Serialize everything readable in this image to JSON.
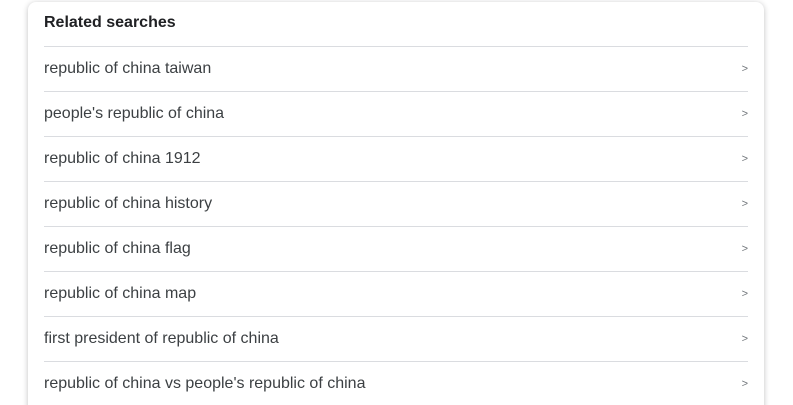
{
  "related_searches": {
    "title": "Related searches",
    "chevron_glyph": ">",
    "items": [
      {
        "label": "republic of china taiwan"
      },
      {
        "label": "people's republic of china"
      },
      {
        "label": "republic of china 1912"
      },
      {
        "label": "republic of china history"
      },
      {
        "label": "republic of china flag"
      },
      {
        "label": "republic of china map"
      },
      {
        "label": "first president of republic of china"
      },
      {
        "label": "republic of china vs people's republic of china"
      }
    ]
  },
  "colors": {
    "title_text": "#202124",
    "item_text": "#3c4043",
    "divider": "#dadce0",
    "chevron": "#70757a"
  }
}
